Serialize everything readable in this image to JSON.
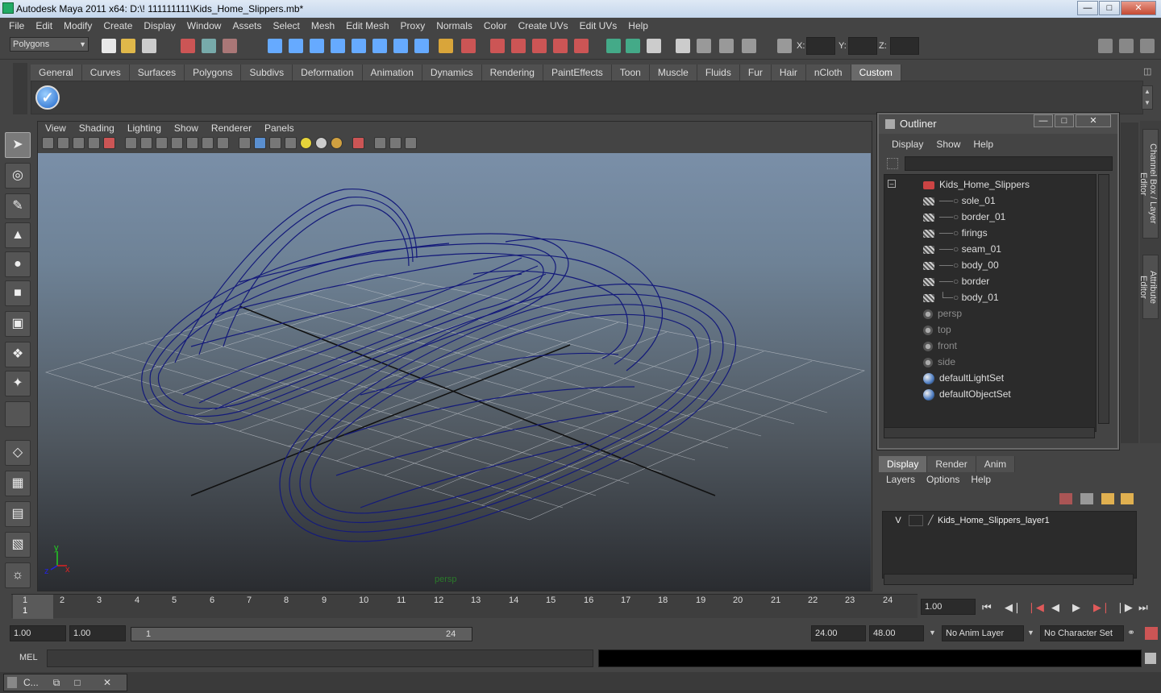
{
  "window": {
    "title": "Autodesk Maya 2011 x64: D:\\! 111111111\\Kids_Home_Slippers.mb*"
  },
  "menubar": [
    "File",
    "Edit",
    "Modify",
    "Create",
    "Display",
    "Window",
    "Assets",
    "Select",
    "Mesh",
    "Edit Mesh",
    "Proxy",
    "Normals",
    "Color",
    "Create UVs",
    "Edit UVs",
    "Help"
  ],
  "toolbar": {
    "mode": "Polygons",
    "x_label": "X:",
    "y_label": "Y:",
    "z_label": "Z:"
  },
  "shelf": {
    "tabs": [
      "General",
      "Curves",
      "Surfaces",
      "Polygons",
      "Subdivs",
      "Deformation",
      "Animation",
      "Dynamics",
      "Rendering",
      "PaintEffects",
      "Toon",
      "Muscle",
      "Fluids",
      "Fur",
      "Hair",
      "nCloth",
      "Custom"
    ],
    "active_tab": "Custom"
  },
  "viewport": {
    "menu": [
      "View",
      "Shading",
      "Lighting",
      "Show",
      "Renderer",
      "Panels"
    ],
    "camera_label": "persp",
    "axis": {
      "x": "x",
      "y": "y",
      "z": "z"
    }
  },
  "outliner": {
    "title": "Outliner",
    "menu": [
      "Display",
      "Show",
      "Help"
    ],
    "items": [
      {
        "label": "Kids_Home_Slippers",
        "type": "group",
        "dim": false
      },
      {
        "label": "sole_01",
        "type": "mesh",
        "dim": false
      },
      {
        "label": "border_01",
        "type": "mesh",
        "dim": false
      },
      {
        "label": "firings",
        "type": "mesh",
        "dim": false
      },
      {
        "label": "seam_01",
        "type": "mesh",
        "dim": false
      },
      {
        "label": "body_00",
        "type": "mesh",
        "dim": false
      },
      {
        "label": "border",
        "type": "mesh",
        "dim": false
      },
      {
        "label": "body_01",
        "type": "mesh",
        "dim": false
      },
      {
        "label": "persp",
        "type": "camera",
        "dim": true
      },
      {
        "label": "top",
        "type": "camera",
        "dim": true
      },
      {
        "label": "front",
        "type": "camera",
        "dim": true
      },
      {
        "label": "side",
        "type": "camera",
        "dim": true
      },
      {
        "label": "defaultLightSet",
        "type": "set",
        "dim": false
      },
      {
        "label": "defaultObjectSet",
        "type": "set",
        "dim": false
      }
    ]
  },
  "right_dock": {
    "tabs": [
      "Channel Box / Layer Editor",
      "Attribute Editor"
    ]
  },
  "layers": {
    "tabs": [
      "Display",
      "Render",
      "Anim"
    ],
    "active_tab": "Display",
    "menu": [
      "Layers",
      "Options",
      "Help"
    ],
    "rows": [
      {
        "visible": "V",
        "name": "Kids_Home_Slippers_layer1"
      }
    ]
  },
  "timeline": {
    "ticks": [
      "1",
      "2",
      "3",
      "4",
      "5",
      "6",
      "7",
      "8",
      "9",
      "10",
      "11",
      "12",
      "13",
      "14",
      "15",
      "16",
      "17",
      "18",
      "19",
      "20",
      "21",
      "22",
      "23",
      "24"
    ],
    "current_frame_marker": "1",
    "current_time": "1.00"
  },
  "range": {
    "start": "1.00",
    "inner_start": "1.00",
    "slider_start": "1",
    "slider_end": "24",
    "inner_end": "24.00",
    "end": "48.00",
    "anim_layer": "No Anim Layer",
    "character_set": "No Character Set"
  },
  "command_line": {
    "label": "MEL"
  },
  "taskbar": {
    "minimized_label": "C..."
  }
}
